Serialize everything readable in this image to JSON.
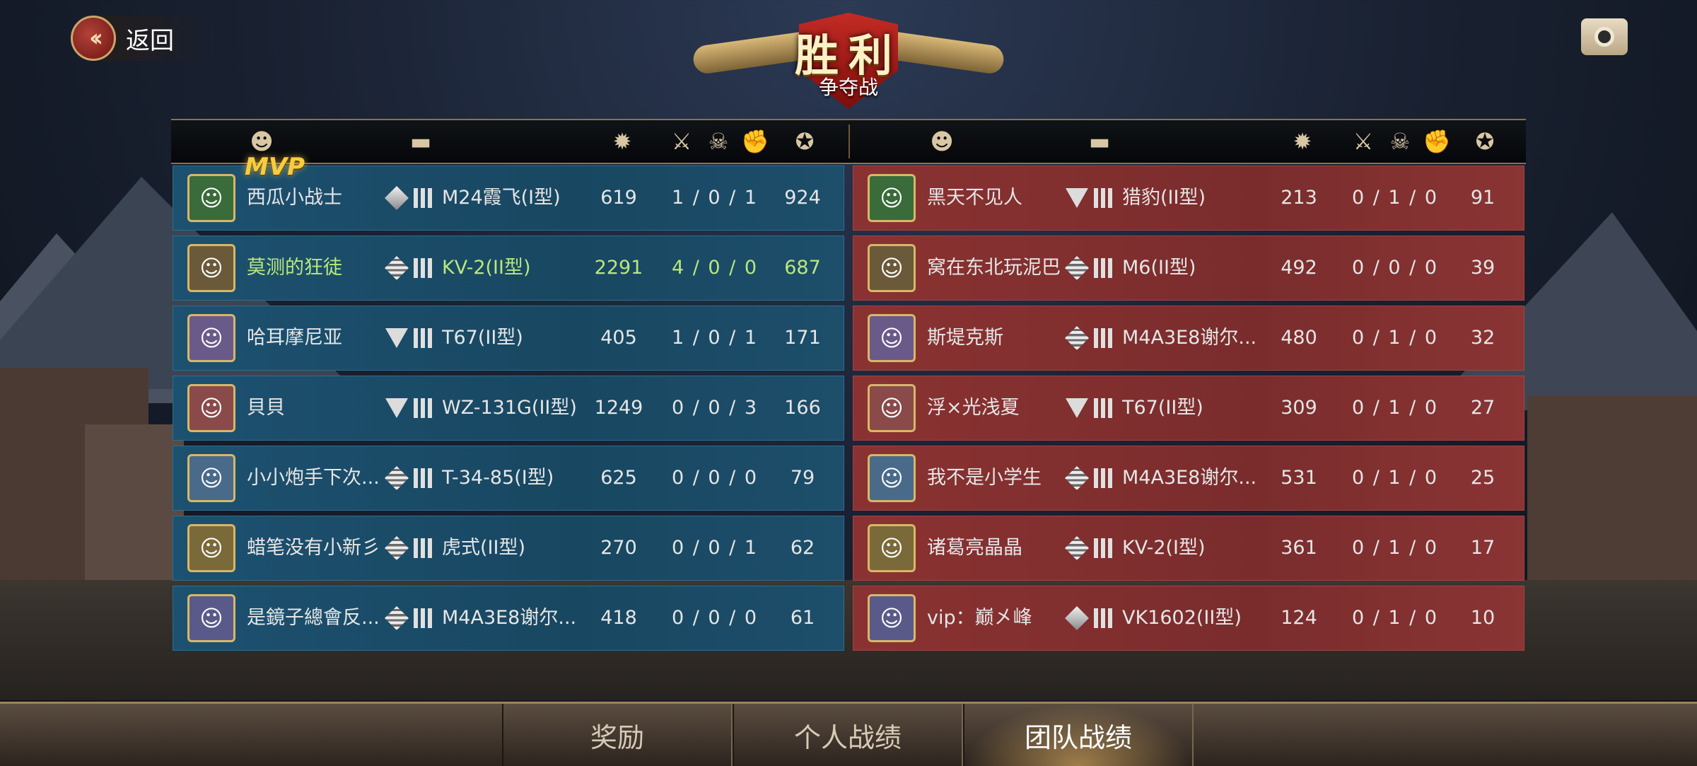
{
  "header": {
    "back_label": "返回",
    "victory_title": "胜利",
    "mode_subtitle": "争夺战"
  },
  "icons": {
    "column_headers": [
      "player-icon",
      "tank-icon",
      "damage-icon",
      "kills-icon",
      "deaths-icon",
      "assists-icon",
      "score-icon"
    ]
  },
  "mvp_label": "MVP",
  "left_team": [
    {
      "name": "西瓜小战士",
      "rank": "diamond",
      "tank": "M24霞飞(I型)",
      "damage": "619",
      "kda": "1 / 0 / 1",
      "score": "924"
    },
    {
      "name": "莫测的狂徒",
      "rank": "stripes",
      "tank": "KV-2(II型)",
      "damage": "2291",
      "kda": "4 / 0 / 0",
      "score": "687",
      "highlight": true
    },
    {
      "name": "哈耳摩尼亚",
      "rank": "triangle",
      "tank": "T67(II型)",
      "damage": "405",
      "kda": "1 / 0 / 1",
      "score": "171"
    },
    {
      "name": "貝貝",
      "rank": "triangle",
      "tank": "WZ-131G(II型)",
      "damage": "1249",
      "kda": "0 / 0 / 3",
      "score": "166"
    },
    {
      "name": "小小炮手下次...",
      "rank": "stripes",
      "tank": "T-34-85(I型)",
      "damage": "625",
      "kda": "0 / 0 / 0",
      "score": "79"
    },
    {
      "name": "蜡笔没有小新彡",
      "rank": "stripes",
      "tank": "虎式(II型)",
      "damage": "270",
      "kda": "0 / 0 / 1",
      "score": "62"
    },
    {
      "name": "是鏡子總會反...",
      "rank": "stripes",
      "tank": "M4A3E8谢尔...",
      "damage": "418",
      "kda": "0 / 0 / 0",
      "score": "61"
    }
  ],
  "right_team": [
    {
      "name": "黑天不见人",
      "rank": "triangle",
      "tank": "猎豹(II型)",
      "damage": "213",
      "kda": "0 / 1 / 0",
      "score": "91"
    },
    {
      "name": "窝在东北玩泥巴",
      "rank": "stripes",
      "tank": "M6(II型)",
      "damage": "492",
      "kda": "0 / 0 / 0",
      "score": "39"
    },
    {
      "name": "斯堤克斯",
      "rank": "stripes",
      "tank": "M4A3E8谢尔...",
      "damage": "480",
      "kda": "0 / 1 / 0",
      "score": "32"
    },
    {
      "name": "浮×光浅夏",
      "rank": "triangle",
      "tank": "T67(II型)",
      "damage": "309",
      "kda": "0 / 1 / 0",
      "score": "27"
    },
    {
      "name": "我不是小学生",
      "rank": "stripes",
      "tank": "M4A3E8谢尔...",
      "damage": "531",
      "kda": "0 / 1 / 0",
      "score": "25"
    },
    {
      "name": "诸葛亮晶晶",
      "rank": "stripes",
      "tank": "KV-2(I型)",
      "damage": "361",
      "kda": "0 / 1 / 0",
      "score": "17"
    },
    {
      "name": "vip：巅㐅峰",
      "rank": "diamond",
      "tank": "VK1602(II型)",
      "damage": "124",
      "kda": "0 / 1 / 0",
      "score": "10"
    }
  ],
  "tabs": [
    "奖励",
    "个人战绩",
    "团队战绩"
  ],
  "active_tab": "团队战绩",
  "colors": {
    "left_team": "#1d5170",
    "right_team": "#8a3232",
    "highlight": "#b9e87c",
    "mvp": "#f7cc3f"
  }
}
